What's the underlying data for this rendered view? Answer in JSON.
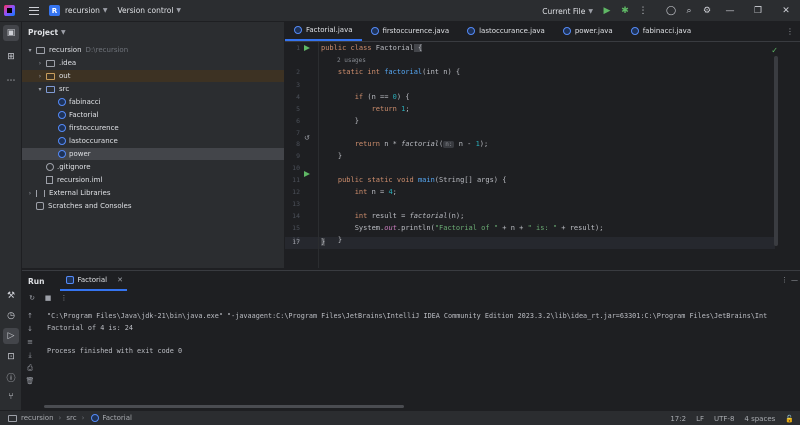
{
  "titlebar": {
    "project_badge": "R",
    "project_name": "recursion",
    "vcs_label": "Version control",
    "run_config": "Current File",
    "icons": [
      "app-logo",
      "main-menu-icon",
      "run-icon",
      "debug-icon",
      "more-icon",
      "profile-icon",
      "search-icon",
      "settings-icon",
      "minimize-icon",
      "restore-icon",
      "close-icon"
    ]
  },
  "project_panel": {
    "title": "Project",
    "root": {
      "name": "recursion",
      "path": "D:\\recursion"
    },
    "items": [
      {
        "label": ".idea",
        "type": "folder"
      },
      {
        "label": "out",
        "type": "folder-excluded"
      },
      {
        "label": "src",
        "type": "folder-source"
      },
      {
        "label": "fabinacci",
        "type": "class"
      },
      {
        "label": "Factorial",
        "type": "class"
      },
      {
        "label": "firstoccurence",
        "type": "class"
      },
      {
        "label": "lastoccurance",
        "type": "class"
      },
      {
        "label": "power",
        "type": "class"
      },
      {
        "label": ".gitignore",
        "type": "file"
      },
      {
        "label": "recursion.iml",
        "type": "file"
      },
      {
        "label": "External Libraries",
        "type": "library"
      },
      {
        "label": "Scratches and Consoles",
        "type": "scratch"
      }
    ]
  },
  "editor": {
    "tabs": [
      {
        "label": "Factorial.java",
        "active": true
      },
      {
        "label": "firstoccurence.java",
        "active": false
      },
      {
        "label": "lastoccurance.java",
        "active": false
      },
      {
        "label": "power.java",
        "active": false
      },
      {
        "label": "fabinacci.java",
        "active": false
      }
    ],
    "line_numbers": [
      "1",
      "2",
      "3",
      "4",
      "5",
      "6",
      "7",
      "8",
      "9",
      "10",
      "11",
      "12",
      "13",
      "14",
      "15",
      "16",
      "17"
    ],
    "usages_hint": "2 usages",
    "inlay_hint": "n:",
    "code": {
      "l1_kw": "public class ",
      "l1_name": "Factorial",
      "l1_brace": " {",
      "l2_kw": "static int ",
      "l2_fn": "factorial",
      "l2_rest": "(int n) {",
      "l4_kw": "if",
      "l4_a": " (n == ",
      "l4_num": "0",
      "l4_b": ") {",
      "l5_kw": "return ",
      "l5_num": "1",
      "l5_end": ";",
      "l6": "}",
      "l8_kw": "return ",
      "l8_a": "n * ",
      "l8_fn": "factorial",
      "l8_b": "(",
      "l8_c": "n - ",
      "l8_num": "1",
      "l8_d": ");",
      "l9": "}",
      "l11_kw": "public static void ",
      "l11_fn": "main",
      "l11_rest": "(String[] args) {",
      "l12_kw": "int ",
      "l12_a": "n = ",
      "l12_num": "4",
      "l12_end": ";",
      "l14_kw": "int ",
      "l14_a": "result = ",
      "l14_fn": "factorial",
      "l14_b": "(n);",
      "l15_a": "System.",
      "l15_out": "out",
      "l15_b": ".println(",
      "l15_s1": "\"Factorial of \"",
      "l15_c": " + n + ",
      "l15_s2": "\" is: \"",
      "l15_d": " + result);",
      "l16": "}",
      "l17": "}"
    }
  },
  "run_panel": {
    "title": "Run",
    "tab_label": "Factorial",
    "console": [
      "\"C:\\Program Files\\Java\\jdk-21\\bin\\java.exe\" \"-javaagent:C:\\Program Files\\JetBrains\\IntelliJ IDEA Community Edition 2023.3.2\\lib\\idea_rt.jar=63301:C:\\Program Files\\JetBrains\\Int",
      "Factorial of 4 is: 24",
      "",
      "Process finished with exit code 0"
    ]
  },
  "statusbar": {
    "breadcrumbs": [
      "recursion",
      "src",
      "Factorial"
    ],
    "position": "17:2",
    "line_sep": "LF",
    "encoding": "UTF-8",
    "indent": "4 spaces"
  },
  "colors": {
    "accent": "#3574f0",
    "background": "#1e1f22",
    "panel": "#2b2d30",
    "keyword": "#cf8e6d",
    "function": "#56a8f5",
    "number": "#2aacb8",
    "string": "#6aab73",
    "run_green": "#5fb865"
  }
}
